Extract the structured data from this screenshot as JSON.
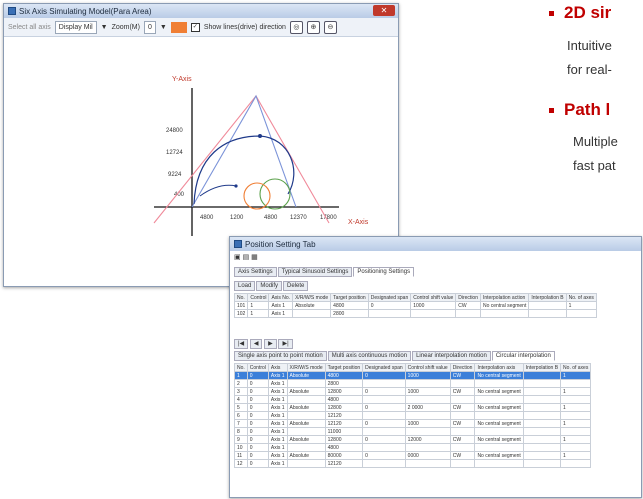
{
  "upper_window": {
    "title": "Six Axis Simulating Model(Para Area)",
    "close_label": "✕",
    "toolbar": {
      "left_label": "Select all axis",
      "dropdown_value": "Display Mil",
      "zoom_label": "Zoom(M)",
      "zoom_value": "0",
      "checkbox_label": "Show lines(drive) direction",
      "icons": [
        "target-icon",
        "zoom-in-icon",
        "zoom-out-icon"
      ]
    },
    "chart": {
      "y_axis_label": "Y-Axis",
      "x_axis_label": "X-Axis",
      "y_ticks": [
        "24800",
        "12724",
        "9224",
        "400"
      ],
      "x_ticks": [
        "4800",
        "1200",
        "4800",
        "12370",
        "17800"
      ],
      "colors": {
        "pink": "#f08a9a",
        "blue_line": "#7b93d8",
        "navy": "#1f3a8a",
        "orange": "#f07f35",
        "green": "#5aa04a"
      }
    }
  },
  "bullets": [
    {
      "title": "2D sir",
      "desc_lines": [
        "Intuitive",
        "for real-"
      ]
    },
    {
      "title": "Path l",
      "desc_lines": [
        "Multiple",
        "fast pat"
      ]
    }
  ],
  "lower_window": {
    "title": "Position Setting Tab",
    "tabs": [
      "Axis Settings",
      "Typical Sinusoid Settings",
      "Positioning Settings"
    ],
    "subtabs": [
      "Load",
      "Modify",
      "Delete"
    ],
    "top_headers": [
      "No.",
      "Control",
      "Axis No.",
      "X/R/W/S mode",
      "Target position",
      "Designated span",
      "Control shift value",
      "Direction",
      "Interpolation action",
      "Interpolation B",
      "No. of axes"
    ],
    "top_rows": [
      [
        "101",
        "1",
        "Axis 1",
        "Absolute",
        "4800",
        "0",
        "1000",
        "CW",
        "No central segment",
        "",
        "1"
      ],
      [
        "102",
        "1",
        "Axis 1",
        "",
        "2800",
        "",
        "",
        "",
        "",
        "",
        ""
      ]
    ],
    "section_tabs": [
      "Single axis point to point motion",
      "Multi axis continuous motion",
      "Linear interpolation motion",
      "Circular interpolation"
    ],
    "grid_headers": [
      "No.",
      "Control",
      "Axis",
      "X/R/W/S mode",
      "Target position",
      "Designated span",
      "Control shift value",
      "Direction",
      "Interpolation axis",
      "Interpolation B",
      "No. of axes"
    ],
    "grid_rows": [
      [
        "1",
        "0",
        "Axis 1",
        "Absolute",
        "4800",
        "0",
        "1000",
        "CW",
        "No central segment",
        "",
        "1"
      ],
      [
        "2",
        "0",
        "Axis 1",
        "",
        "2800",
        "",
        "",
        "",
        "",
        "",
        ""
      ],
      [
        "3",
        "0",
        "Axis 1",
        "Absolute",
        "12800",
        "0",
        "1000",
        "CW",
        "No central segment",
        "",
        "1"
      ],
      [
        "4",
        "0",
        "Axis 1",
        "",
        "4800",
        "",
        "",
        "",
        "",
        "",
        ""
      ],
      [
        "5",
        "0",
        "Axis 1",
        "Absolute",
        "12800",
        "0",
        "2 0000",
        "CW",
        "No central segment",
        "",
        "1"
      ],
      [
        "6",
        "0",
        "Axis 1",
        "",
        "12120",
        "",
        "",
        "",
        "",
        "",
        ""
      ],
      [
        "7",
        "0",
        "Axis 1",
        "Absolute",
        "12120",
        "0",
        "1000",
        "CW",
        "No central segment",
        "",
        "1"
      ],
      [
        "8",
        "0",
        "Axis 1",
        "",
        "11000",
        "",
        "",
        "",
        "",
        "",
        ""
      ],
      [
        "9",
        "0",
        "Axis 1",
        "Absolute",
        "12800",
        "0",
        "12000",
        "CW",
        "No central segment",
        "",
        "1"
      ],
      [
        "10",
        "0",
        "Axis 1",
        "",
        "4800",
        "",
        "",
        "",
        "",
        "",
        ""
      ],
      [
        "11",
        "0",
        "Axis 1",
        "Absolute",
        "80000",
        "0",
        "0000",
        "CW",
        "No central segment",
        "",
        "1"
      ],
      [
        "12",
        "0",
        "Axis 1",
        "",
        "12120",
        "",
        "",
        "",
        "",
        "",
        ""
      ]
    ]
  }
}
